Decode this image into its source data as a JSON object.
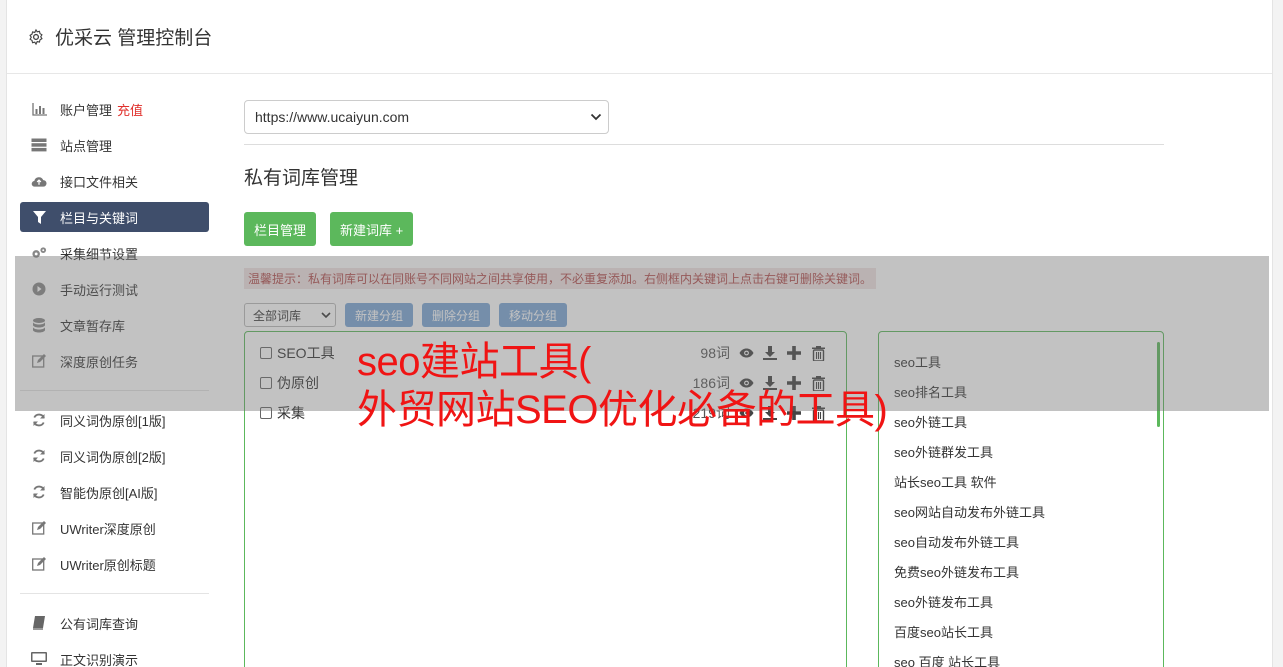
{
  "header": {
    "title": "优采云 管理控制台"
  },
  "sidebar": {
    "items": [
      {
        "label": "账户管理",
        "badge": "充值",
        "icon": "bar-chart-icon"
      },
      {
        "label": "站点管理",
        "icon": "server-icon"
      },
      {
        "label": "接口文件相关",
        "icon": "cloud-upload-icon"
      },
      {
        "label": "栏目与关键词",
        "icon": "filter-icon",
        "active": true
      },
      {
        "label": "采集细节设置",
        "icon": "cogs-icon"
      },
      {
        "label": "手动运行测试",
        "icon": "play-circle-icon"
      },
      {
        "label": "文章暂存库",
        "icon": "database-icon"
      },
      {
        "label": "深度原创任务",
        "icon": "edit-icon"
      },
      {
        "label": "同义词伪原创[1版]",
        "icon": "refresh-icon"
      },
      {
        "label": "同义词伪原创[2版]",
        "icon": "refresh-icon"
      },
      {
        "label": "智能伪原创[AI版]",
        "icon": "refresh-icon"
      },
      {
        "label": "UWriter深度原创",
        "icon": "edit-icon"
      },
      {
        "label": "UWriter原创标题",
        "icon": "edit-icon"
      },
      {
        "label": "公有词库查询",
        "icon": "book-icon"
      },
      {
        "label": "正文识别演示",
        "icon": "monitor-icon"
      }
    ]
  },
  "main": {
    "site_select": "https://www.ucaiyun.com",
    "section_title": "私有词库管理",
    "buttons": {
      "column_manage": "栏目管理",
      "new_library": "新建词库 +"
    },
    "tip": "温馨提示：私有词库可以在同账号不同网站之间共享使用，不必重复添加。右侧框内关键词上点击右键可删除关键词。",
    "group_select": "全部词库",
    "group_buttons": {
      "new_group": "新建分组",
      "delete_group": "删除分组",
      "move_group": "移动分组"
    },
    "libraries": [
      {
        "name": "SEO工具",
        "count": "98词"
      },
      {
        "name": "伪原创",
        "count": "186词"
      },
      {
        "name": "采集",
        "count": "219词"
      }
    ],
    "keywords": [
      "seo工具",
      "seo排名工具",
      "seo外链工具",
      "seo外链群发工具",
      "站长seo工具 软件",
      "seo网站自动发布外链工具",
      "seo自动发布外链工具",
      "免费seo外链发布工具",
      "seo外链发布工具",
      "百度seo站长工具",
      "seo 百度 站长工具"
    ]
  },
  "overlay": {
    "line1": "seo建站工具(",
    "line2": "外贸网站SEO优化必备的工具)"
  },
  "colors": {
    "accent_green": "#5cb85c",
    "nav_active": "#3f4e6b",
    "overlay_red": "#f01414"
  }
}
